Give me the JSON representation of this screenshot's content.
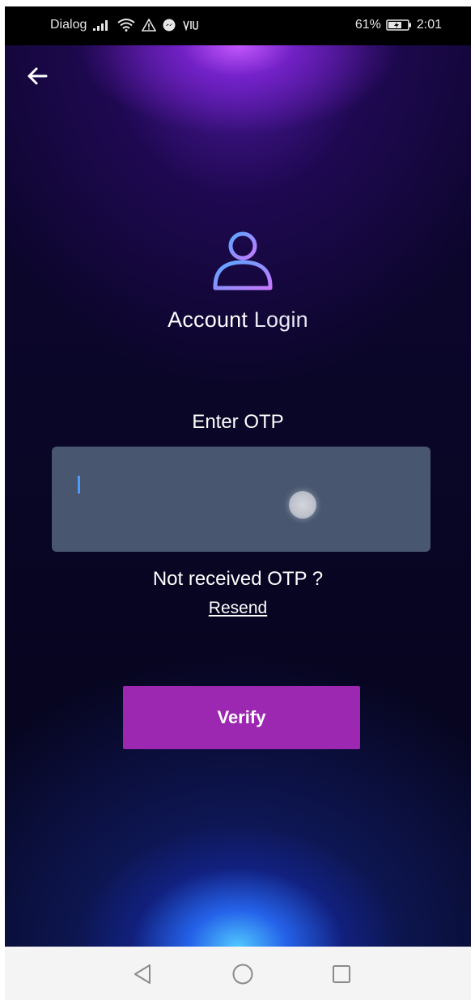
{
  "status_bar": {
    "carrier": "Dialog",
    "battery": "61%",
    "time": "2:01"
  },
  "header": {
    "back_icon": "arrow-left-icon"
  },
  "brand": {
    "word1": "Account",
    "word2": "Login",
    "icon": "user-icon"
  },
  "otp": {
    "label": "Enter OTP",
    "value": "",
    "placeholder": ""
  },
  "resend_section": {
    "prompt": "Not received OTP ?",
    "link": "Resend"
  },
  "actions": {
    "verify_label": "Verify"
  },
  "colors": {
    "verify_button": "#9c27b0",
    "input_background": "#48576f",
    "caret": "#4a9dff",
    "icon_gradient_start": "#58a8ff",
    "icon_gradient_end": "#c678ff"
  },
  "nav": {
    "back": "triangle-back-icon",
    "home": "circle-home-icon",
    "recents": "square-recents-icon"
  }
}
